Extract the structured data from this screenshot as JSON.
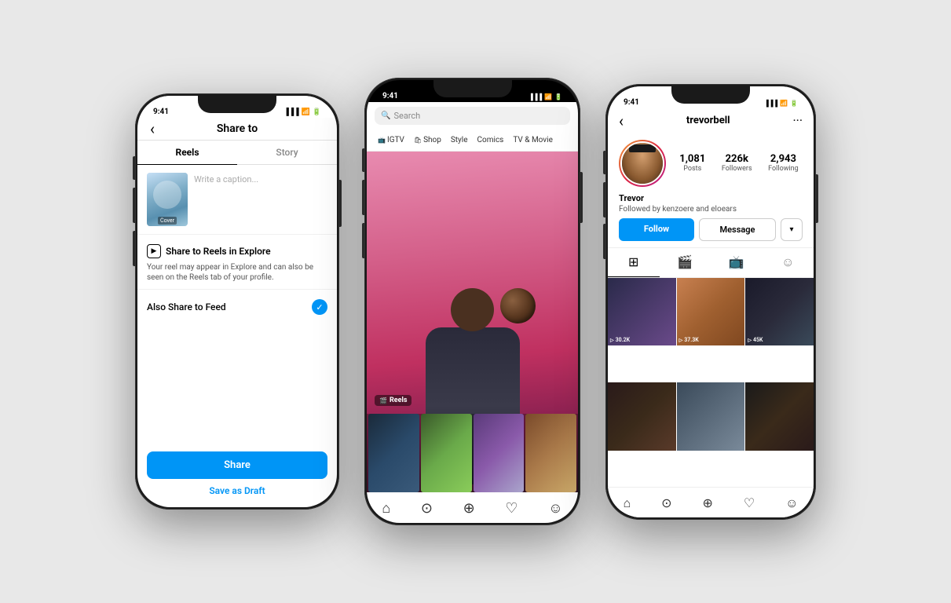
{
  "scene": {
    "background": "#e8e8e8"
  },
  "phone1": {
    "status_time": "9:41",
    "header_title": "Share to",
    "back_label": "‹",
    "tabs": [
      {
        "label": "Reels",
        "active": true
      },
      {
        "label": "Story",
        "active": false
      }
    ],
    "caption_placeholder": "Write a caption...",
    "cover_label": "Cover",
    "explore_title": "Share to Reels in Explore",
    "explore_icon": "▶",
    "explore_desc": "Your reel may appear in Explore and can also be seen on the Reels tab of your profile.",
    "also_share_label": "Also Share to Feed",
    "checkmark": "✓",
    "share_button": "Share",
    "draft_button": "Save as Draft"
  },
  "phone2": {
    "status_time": "9:41",
    "search_placeholder": "Search",
    "categories": [
      {
        "icon": "📺",
        "label": "IGTV"
      },
      {
        "icon": "🛍",
        "label": "Shop"
      },
      {
        "icon": "",
        "label": "Style"
      },
      {
        "icon": "",
        "label": "Comics"
      },
      {
        "icon": "",
        "label": "TV & Movie"
      }
    ],
    "reels_badge": "Reels",
    "nav_icons": [
      "⌂",
      "⊙",
      "⊕",
      "♡",
      "☺"
    ]
  },
  "phone3": {
    "status_time": "9:41",
    "username": "trevorbell",
    "more_icon": "···",
    "back_label": "‹",
    "stats": [
      {
        "num": "1,081",
        "label": "Posts"
      },
      {
        "num": "226k",
        "label": "Followers"
      },
      {
        "num": "2,943",
        "label": "Following"
      }
    ],
    "profile_name": "Trevor",
    "followed_by": "Followed by kenzoere and eloears",
    "follow_btn": "Follow",
    "message_btn": "Message",
    "dropdown_icon": "▾",
    "content_tabs": [
      "⊞",
      "▶",
      "📺",
      "☺"
    ],
    "grid_stats": [
      "▷ 30.2K",
      "▷ 37.3K",
      "▷ 45K",
      "",
      "",
      ""
    ],
    "nav_icons": [
      "⌂",
      "⊙",
      "⊕",
      "♡",
      "☺"
    ]
  }
}
